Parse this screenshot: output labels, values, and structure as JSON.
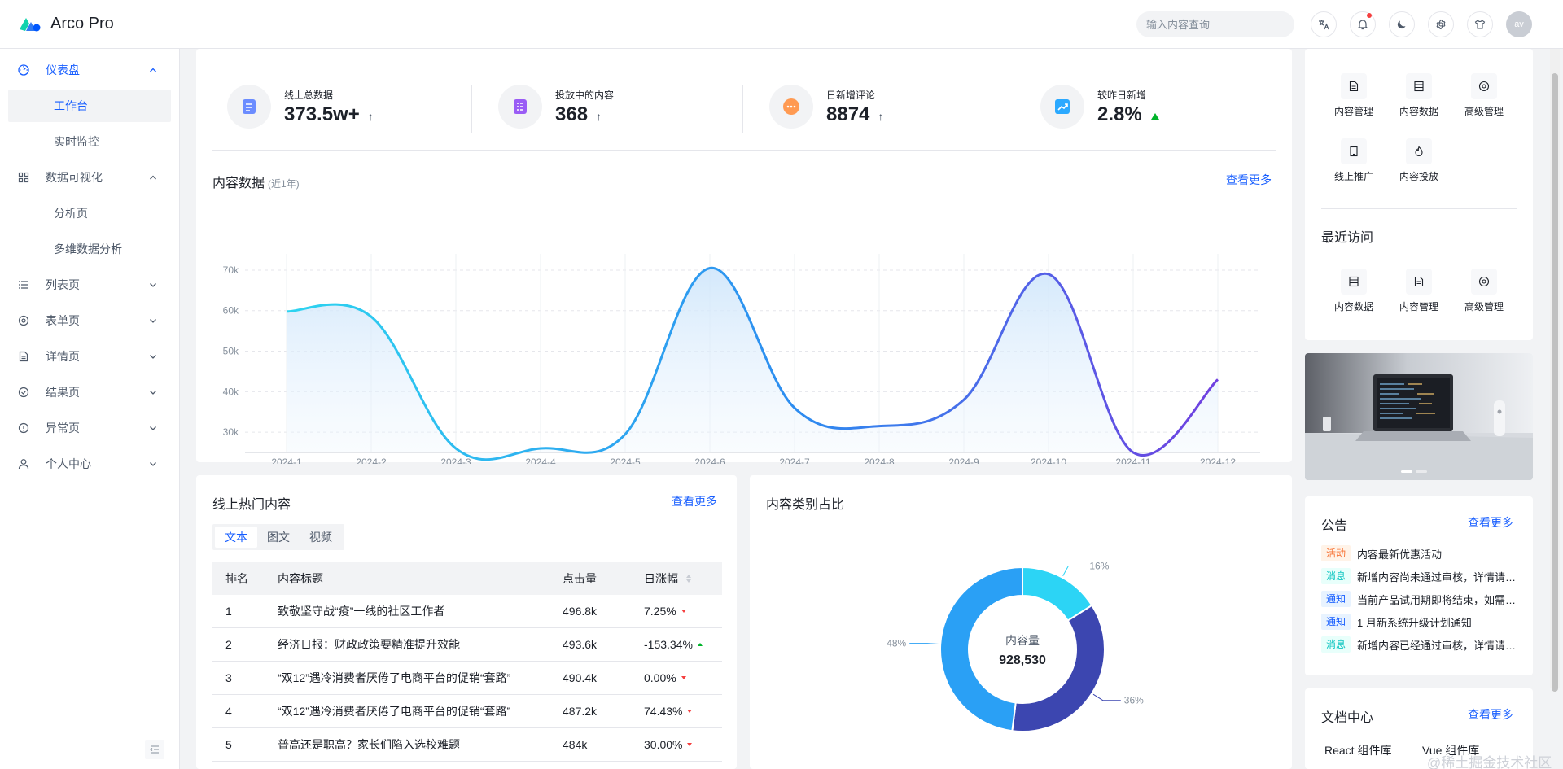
{
  "header": {
    "app_name": "Arco Pro",
    "search_placeholder": "输入内容查询",
    "avatar_alt": "av"
  },
  "sidebar": {
    "items": [
      {
        "label": "仪表盘",
        "icon": "dashboard-icon",
        "expanded": true,
        "children": [
          "工作台",
          "实时监控"
        ]
      },
      {
        "label": "数据可视化",
        "icon": "apps-icon",
        "expanded": true,
        "children": [
          "分析页",
          "多维数据分析"
        ]
      },
      {
        "label": "列表页",
        "icon": "list-icon",
        "expanded": false
      },
      {
        "label": "表单页",
        "icon": "settings-icon",
        "expanded": false
      },
      {
        "label": "详情页",
        "icon": "file-icon",
        "expanded": false
      },
      {
        "label": "结果页",
        "icon": "check-circle-icon",
        "expanded": false
      },
      {
        "label": "异常页",
        "icon": "exclamation-circle-icon",
        "expanded": false
      },
      {
        "label": "个人中心",
        "icon": "user-icon",
        "expanded": false
      }
    ],
    "selected": "工作台"
  },
  "overview": {
    "stats": [
      {
        "label": "线上总数据",
        "value": "373.5w+",
        "trend": "↑",
        "icon": "doc-icon",
        "color": "#6b8cff"
      },
      {
        "label": "投放中的内容",
        "value": "368",
        "trend": "↑",
        "icon": "list-doc-icon",
        "color": "#9a5cf5"
      },
      {
        "label": "日新增评论",
        "value": "8874",
        "trend": "↑",
        "icon": "comment-icon",
        "color": "#ff9a52"
      },
      {
        "label": "较昨日新增",
        "value": "2.8%",
        "trend": "up-triangle",
        "icon": "growth-icon",
        "color": "#2ba9ff"
      }
    ],
    "chart_title": "内容数据",
    "chart_subtitle": "(近1年)",
    "more": "查看更多"
  },
  "chart_data": {
    "type": "area",
    "x": [
      "2024-1",
      "2024-2",
      "2024-3",
      "2024-4",
      "2024-5",
      "2024-6",
      "2024-7",
      "2024-8",
      "2024-9",
      "2024-10",
      "2024-11",
      "2024-12"
    ],
    "values": [
      59800,
      58500,
      26000,
      26000,
      29500,
      70500,
      36000,
      31500,
      38000,
      69000,
      25000,
      43000
    ],
    "ylim": [
      25000,
      72000
    ],
    "yticks": [
      "30k",
      "40k",
      "50k",
      "60k",
      "70k"
    ],
    "grid": true,
    "gradient": [
      "#2dd4f0",
      "#2d8cf0",
      "#7040e0"
    ]
  },
  "popular": {
    "title": "线上热门内容",
    "more": "查看更多",
    "tabs": [
      "文本",
      "图文",
      "视频"
    ],
    "active_tab": "文本",
    "columns": [
      "排名",
      "内容标题",
      "点击量",
      "日涨幅"
    ],
    "rows": [
      {
        "rank": "1",
        "title": "致敬坚守战“疫”一线的社区工作者",
        "clicks": "496.8k",
        "change": "7.25%",
        "dir": "down"
      },
      {
        "rank": "2",
        "title": "经济日报：财政政策要精准提升效能",
        "clicks": "493.6k",
        "change": "-153.34%",
        "dir": "up"
      },
      {
        "rank": "3",
        "title": "“双12”遇冷消费者厌倦了电商平台的促销“套路”",
        "clicks": "490.4k",
        "change": "0.00%",
        "dir": "down"
      },
      {
        "rank": "4",
        "title": "“双12”遇冷消费者厌倦了电商平台的促销“套路”",
        "clicks": "487.2k",
        "change": "74.43%",
        "dir": "down"
      },
      {
        "rank": "5",
        "title": "普高还是职高？家长们陷入选校难题",
        "clicks": "484k",
        "change": "30.00%",
        "dir": "down"
      }
    ]
  },
  "category": {
    "title": "内容类别占比",
    "center_label": "内容量",
    "center_value": "928,530",
    "slices": [
      {
        "label": "16%",
        "value": 16,
        "color": "#2cd4f5"
      },
      {
        "label": "36%",
        "value": 36,
        "color": "#3c46b0"
      },
      {
        "label": "48%",
        "value": 48,
        "color": "#2aa0f5"
      }
    ]
  },
  "quick": {
    "items": [
      {
        "label": "内容管理",
        "icon": "file-icon"
      },
      {
        "label": "内容数据",
        "icon": "storage-icon"
      },
      {
        "label": "高级管理",
        "icon": "settings-icon"
      },
      {
        "label": "线上推广",
        "icon": "mobile-icon"
      },
      {
        "label": "内容投放",
        "icon": "fire-icon"
      }
    ],
    "recent_title": "最近访问",
    "recent": [
      {
        "label": "内容数据",
        "icon": "storage-icon"
      },
      {
        "label": "内容管理",
        "icon": "file-icon"
      },
      {
        "label": "高级管理",
        "icon": "settings-icon"
      }
    ]
  },
  "notice": {
    "title": "公告",
    "more": "查看更多",
    "items": [
      {
        "tag": "活动",
        "tag_color": "orange",
        "text": "内容最新优惠活动"
      },
      {
        "tag": "消息",
        "tag_color": "cyan",
        "text": "新增内容尚未通过审核，详情请点击查看"
      },
      {
        "tag": "通知",
        "tag_color": "blue",
        "text": "当前产品试用期即将结束，如需续费请点击查看"
      },
      {
        "tag": "通知",
        "tag_color": "blue",
        "text": "1 月新系统升级计划通知"
      },
      {
        "tag": "消息",
        "tag_color": "cyan",
        "text": "新增内容已经通过审核，详情请点击查看"
      }
    ]
  },
  "docs": {
    "title": "文档中心",
    "more": "查看更多",
    "links": [
      "React 组件库",
      "Vue 组件库"
    ],
    "watermark": "@稀土掘金技术社区"
  }
}
